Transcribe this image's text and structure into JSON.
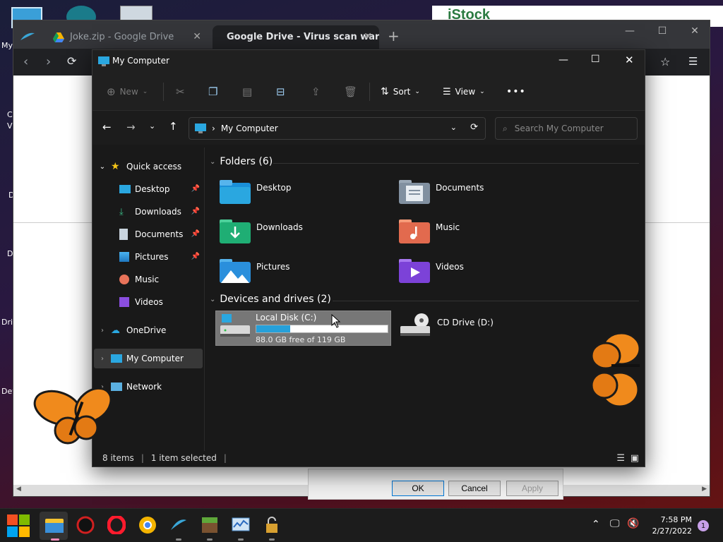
{
  "desktop": {
    "labels": [
      "My",
      "C",
      "V",
      "D",
      "D",
      "Dri",
      "Dev"
    ]
  },
  "background_page": {
    "brand_text": "iStock",
    "dialog": {
      "ok": "OK",
      "cancel": "Cancel",
      "apply": "Apply"
    }
  },
  "browser": {
    "tabs": [
      {
        "title": "Joke.zip - Google Drive",
        "icon": "google-drive-icon"
      },
      {
        "title": "Google Drive - Virus scan warn",
        "icon": "globe-icon"
      }
    ],
    "new_tab": "+"
  },
  "explorer": {
    "title": "My Computer",
    "commands": {
      "new": "New",
      "sort": "Sort",
      "view": "View",
      "more": "•••"
    },
    "address": "My Computer",
    "search_placeholder": "Search My Computer",
    "nav": {
      "quick_access": "Quick access",
      "items": [
        "Desktop",
        "Downloads",
        "Documents",
        "Pictures",
        "Music",
        "Videos"
      ],
      "onedrive": "OneDrive",
      "my_computer": "My Computer",
      "network": "Network"
    },
    "folders_header": "Folders (6)",
    "folders": [
      {
        "name": "Desktop"
      },
      {
        "name": "Documents"
      },
      {
        "name": "Downloads"
      },
      {
        "name": "Music"
      },
      {
        "name": "Pictures"
      },
      {
        "name": "Videos"
      }
    ],
    "drives_header": "Devices and drives (2)",
    "drives": [
      {
        "name": "Local Disk (C:)",
        "free": "88.0 GB free of 119 GB",
        "used_fraction": 0.26
      },
      {
        "name": "CD Drive (D:)"
      }
    ],
    "status": {
      "items": "8 items",
      "selected": "1 item selected"
    }
  },
  "taskbar": {
    "time": "7:58 PM",
    "date": "2/27/2022",
    "notifications": "1"
  },
  "colors": {
    "accent": "#26a0da",
    "explorer_bg": "#191919",
    "taskbar": "#1c1c1c"
  }
}
